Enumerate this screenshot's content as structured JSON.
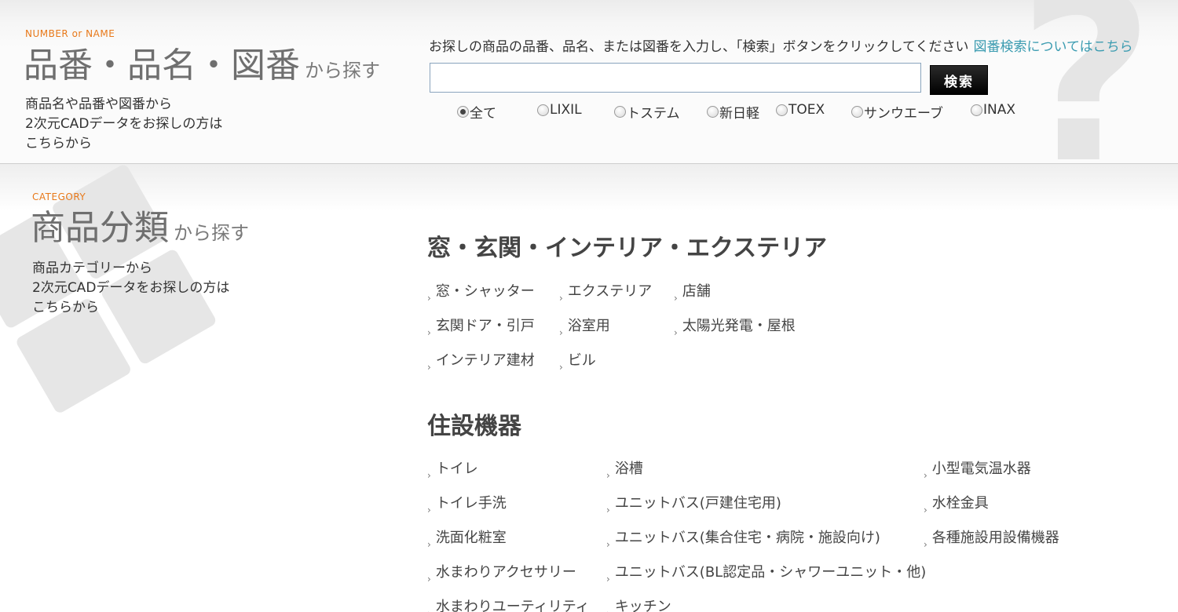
{
  "search_section": {
    "eyebrow": "NUMBER or NAME",
    "title": "品番・品名・図番",
    "title_suffix": "から探す",
    "description": "商品名や品番や図番から\n2次元CADデータをお探しの方は\nこちらから",
    "instruction": "お探しの商品の品番、品名、または図番を入力し、「検索」ボタンをクリックしてください",
    "help_link": "図番検索についてはこちら",
    "input_value": "",
    "search_button": "検索",
    "maker_options": [
      {
        "label": "全て",
        "checked": true
      },
      {
        "label": "LIXIL",
        "checked": false
      },
      {
        "label": "トステム",
        "checked": false
      },
      {
        "label": "新日軽",
        "checked": false
      },
      {
        "label": "TOEX",
        "checked": false
      },
      {
        "label": "サンウエーブ",
        "checked": false
      },
      {
        "label": "INAX",
        "checked": false
      }
    ]
  },
  "category_section": {
    "eyebrow": "CATEGORY",
    "title": "商品分類",
    "title_suffix": "から探す",
    "description": "商品カテゴリーから\n2次元CADデータをお探しの方は\nこちらから",
    "groups": [
      {
        "heading": "窓・玄関・インテリア・エクステリア",
        "items": [
          "窓・シャッター",
          "エクステリア",
          "店舗",
          "玄関ドア・引戸",
          "浴室用",
          "太陽光発電・屋根",
          "インテリア建材",
          "ビル"
        ]
      },
      {
        "heading": "住設機器",
        "items": [
          "トイレ",
          "浴槽",
          "小型電気温水器",
          "トイレ手洗",
          "ユニットバス(戸建住宅用)",
          "水栓金具",
          "洗面化粧室",
          "ユニットバス(集合住宅・病院・施設向け)",
          "各種施設用設備機器",
          "水まわりアクセサリー",
          "ユニットバス(BL認定品・シャワーユニット・他)",
          "水まわりユーティリティ",
          "キッチン"
        ]
      }
    ]
  },
  "colors": {
    "accent": "#e8791a",
    "link": "#3a9bb0",
    "title": "#6f6f6f"
  },
  "icons": {
    "item_arrow": "arrow-icon",
    "background_mark": "question-mark-icon"
  }
}
